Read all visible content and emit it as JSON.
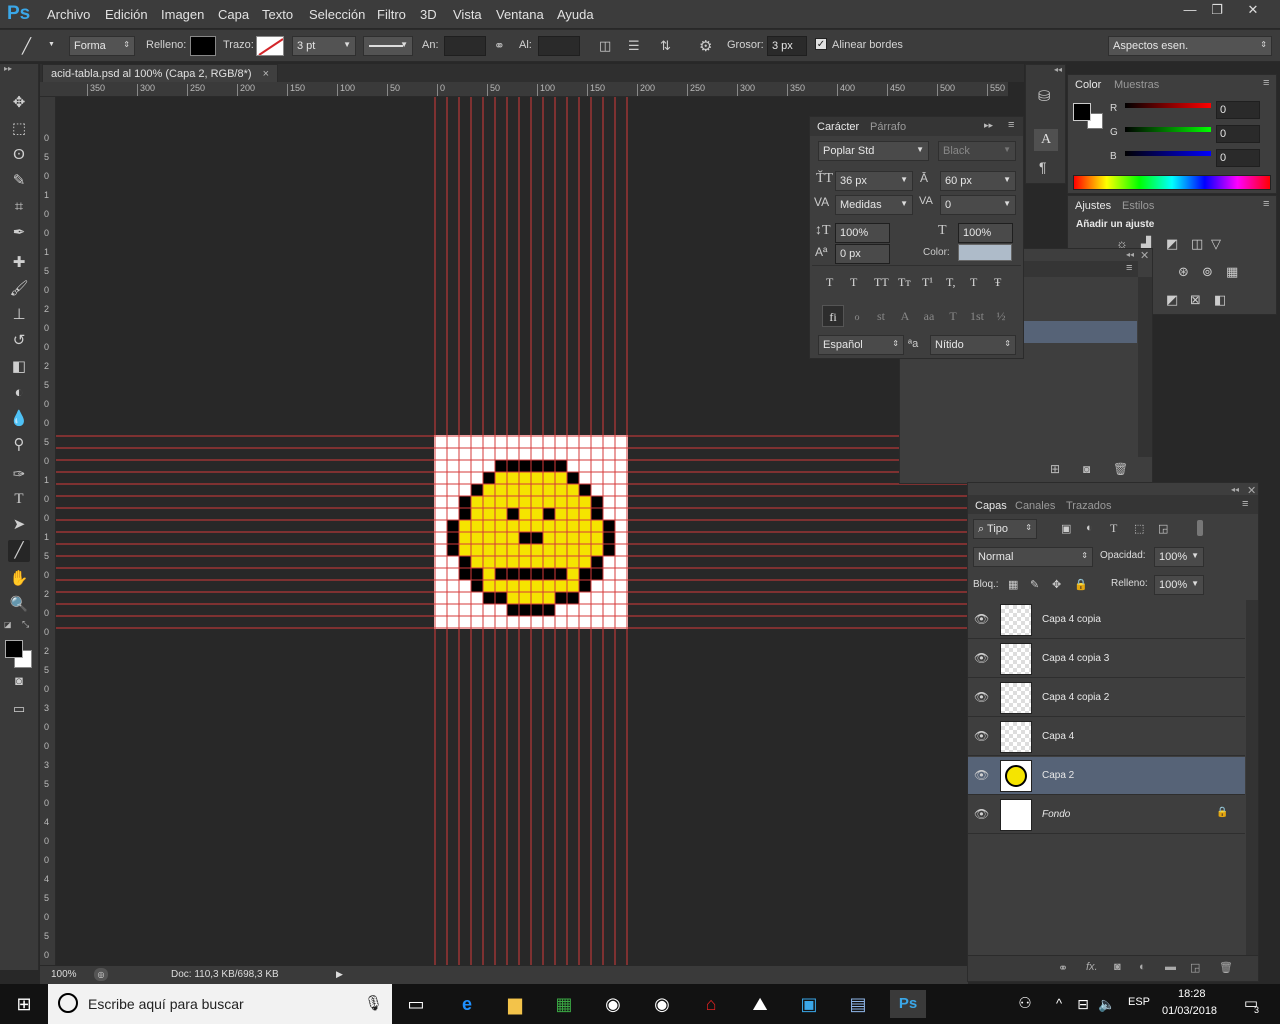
{
  "app": {
    "logo": "Ps"
  },
  "menu": [
    "Archivo",
    "Edición",
    "Imagen",
    "Capa",
    "Texto",
    "Selección",
    "Filtro",
    "3D",
    "Vista",
    "Ventana",
    "Ayuda"
  ],
  "window_controls": {
    "minimize": "—",
    "restore": "❐",
    "close": "✕"
  },
  "options": {
    "mode": "Forma",
    "fill_label": "Relleno:",
    "stroke_label": "Trazo:",
    "stroke_width": "3 pt",
    "width_label": "An:",
    "height_label": "Al:",
    "weight_label": "Grosor:",
    "weight_value": "3 px",
    "align_edges": "Alinear bordes",
    "workspace": "Aspectos esen."
  },
  "document": {
    "tab_title": "acid-tabla.psd al 100% (Capa 2, RGB/8*)",
    "tab_close": "×",
    "h_ruler_labels": [
      "350",
      "300",
      "250",
      "200",
      "150",
      "100",
      "50",
      "0",
      "50",
      "100",
      "150",
      "200",
      "250",
      "300",
      "350",
      "400",
      "450",
      "500",
      "550"
    ],
    "v_ruler_labels": [
      "0",
      "5",
      "0",
      "1",
      "0",
      "0",
      "1",
      "5",
      "0",
      "2",
      "0",
      "0",
      "2",
      "5",
      "0",
      "0",
      "5",
      "0",
      "1",
      "0",
      "0",
      "1",
      "5",
      "0",
      "2",
      "0",
      "0",
      "2",
      "5",
      "0",
      "3",
      "0",
      "0",
      "3",
      "5",
      "0",
      "4",
      "0",
      "0",
      "4",
      "5",
      "0",
      "5",
      "0"
    ],
    "zoom": "100%",
    "doc_info": "Doc: 110,3 KB/698,3 KB"
  },
  "character_panel": {
    "tabs": [
      "Carácter",
      "Párrafo"
    ],
    "font_family": "Poplar Std",
    "font_style": "Black",
    "font_size": "36 px",
    "leading": "60 px",
    "kerning": "Medidas",
    "tracking": "0",
    "vertical_scale": "100%",
    "horizontal_scale": "100%",
    "baseline_shift": "0 px",
    "color_label": "Color:",
    "style_buttons": [
      "T",
      "T",
      "TT",
      "Tт",
      "T¹",
      "T,",
      "T",
      "Ŧ"
    ],
    "opentype_buttons": [
      "fi",
      "ℴ",
      "st",
      "A",
      "aa",
      "T",
      "1st",
      "½"
    ],
    "language": "Español",
    "aa_icon": "ªa",
    "antialias": "Nítido"
  },
  "color_panel": {
    "tabs": [
      "Color",
      "Muestras"
    ],
    "r_label": "R",
    "r_value": "0",
    "g_label": "G",
    "g_value": "0",
    "b_label": "B",
    "b_value": "0"
  },
  "adjustments_panel": {
    "tabs": [
      "Ajustes",
      "Estilos"
    ],
    "title": "Añadir un ajuste"
  },
  "layers_panel": {
    "tabs": [
      "Capas",
      "Canales",
      "Trazados"
    ],
    "filter": "Tipo",
    "blend_mode": "Normal",
    "opacity_label": "Opacidad:",
    "opacity_value": "100%",
    "lock_label": "Bloq.:",
    "fill_label": "Relleno:",
    "fill_value": "100%",
    "layers": [
      {
        "name": "Capa 4 copia",
        "selected": false
      },
      {
        "name": "Capa 4 copia 3",
        "selected": false
      },
      {
        "name": "Capa 4 copia 2",
        "selected": false
      },
      {
        "name": "Capa 4",
        "selected": false
      },
      {
        "name": "Capa 2",
        "selected": true
      },
      {
        "name": "Fondo",
        "selected": false
      }
    ]
  },
  "taskbar": {
    "search_placeholder": "Escribe aquí para buscar",
    "lang": "ESP",
    "time": "18:28",
    "date": "01/03/2018",
    "notif_count": "3"
  },
  "colors": {
    "accent": "#3aa7e8",
    "guide": "#d53a3a",
    "smiley": "#f5e400",
    "selected_layer": "#566377"
  }
}
